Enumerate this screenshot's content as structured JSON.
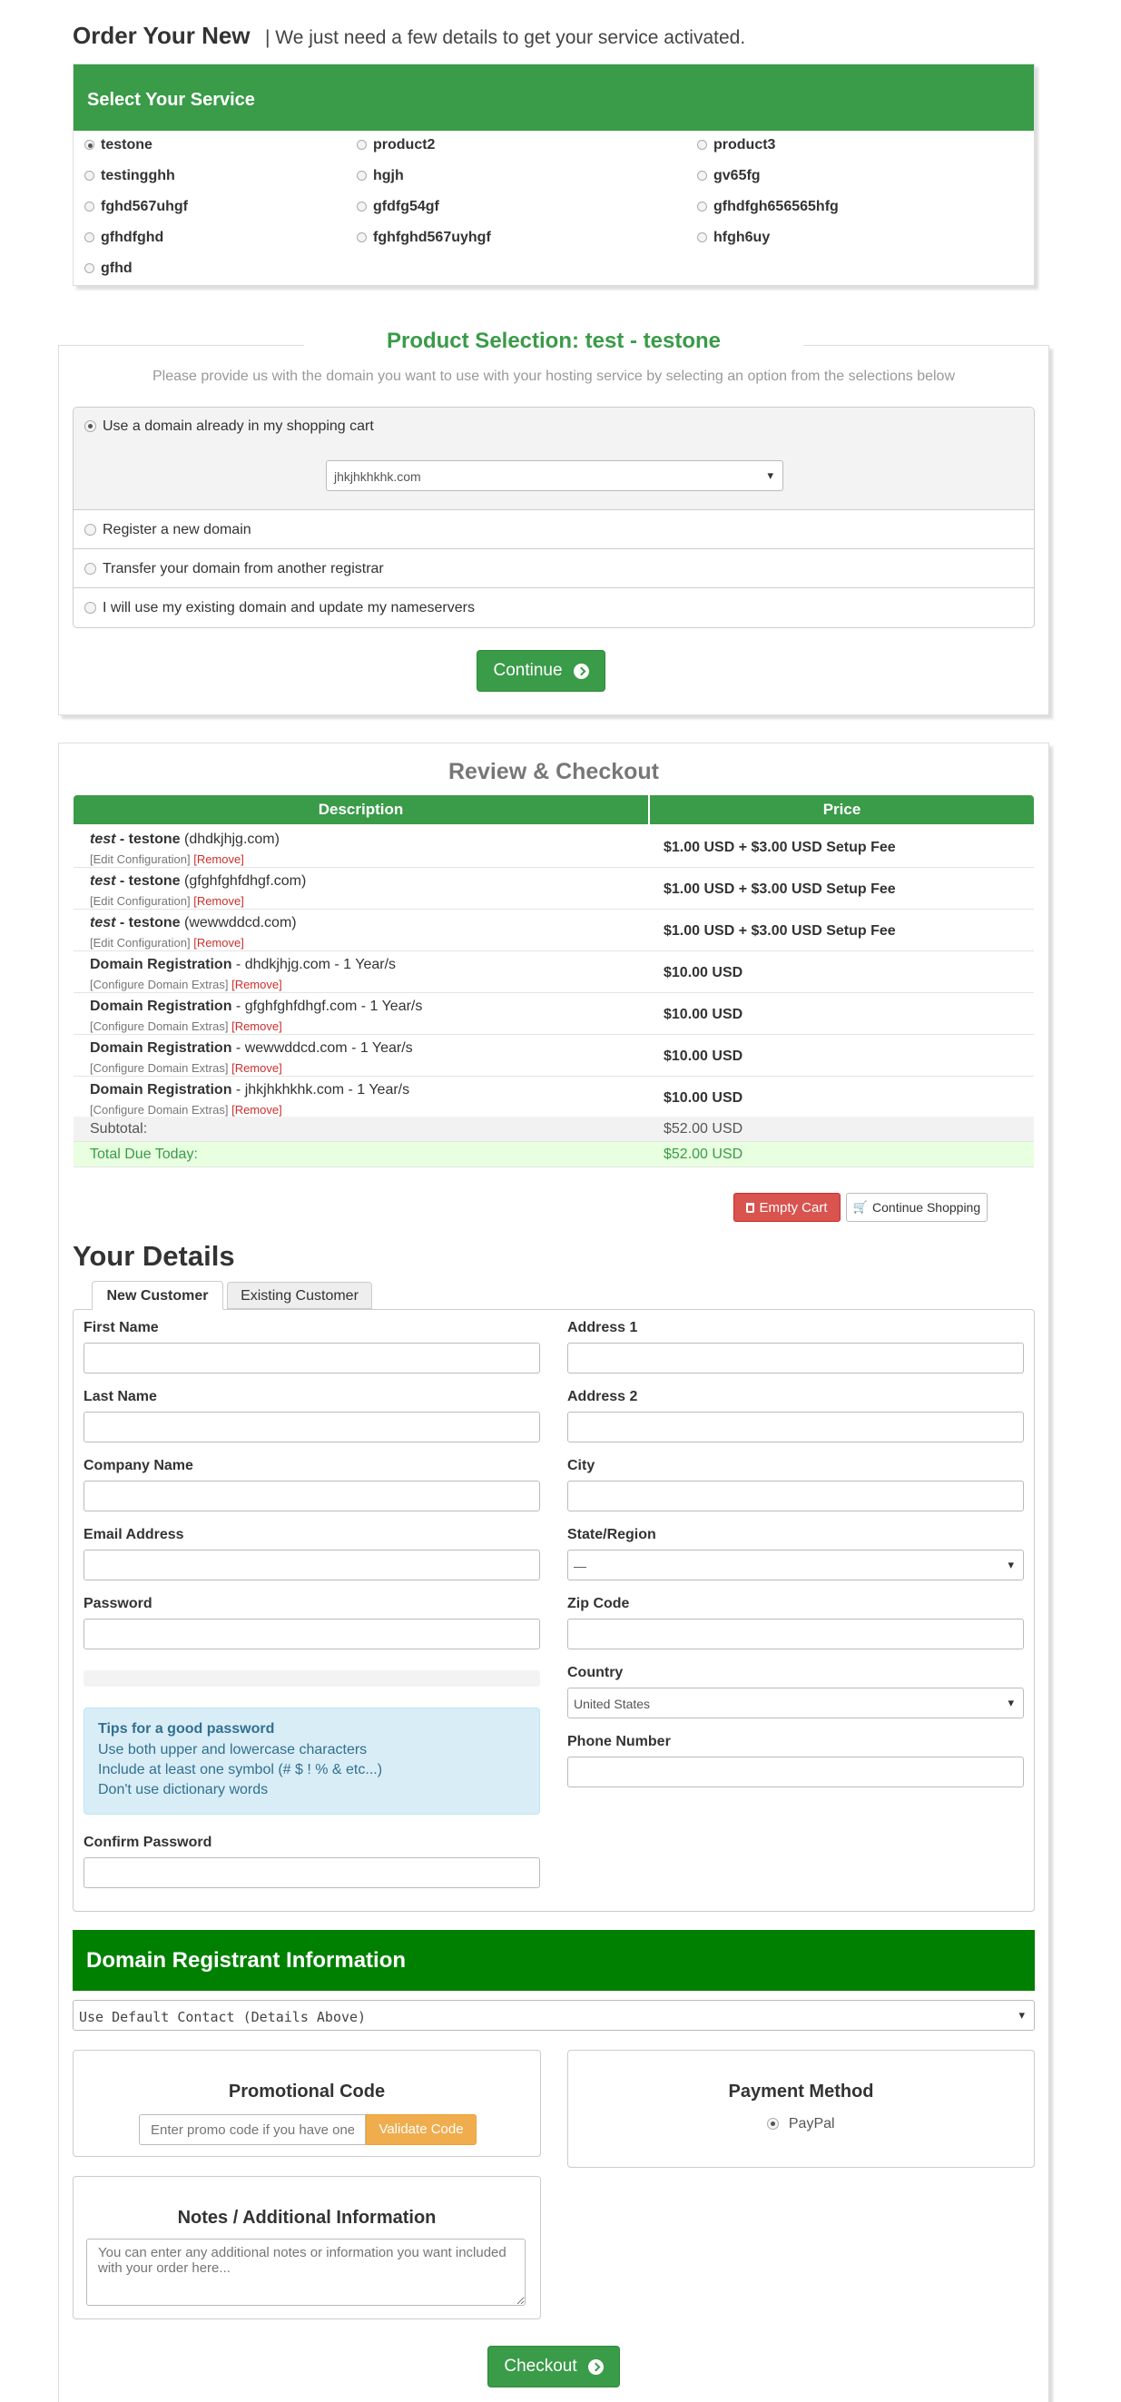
{
  "header": {
    "title": "Order Your New",
    "subtitle": "| We just need a few details to get your service activated."
  },
  "services": {
    "heading": "Select Your Service",
    "items": [
      "testone",
      "product2",
      "product3",
      "testingghh",
      "hgjh",
      "gv65fg",
      "fghd567uhgf",
      "gfdfg54gf",
      "gfhdfgh656565hfg",
      "gfhdfghd",
      "fghfghd567uyhgf",
      "hfgh6uy",
      "gfhd"
    ],
    "selected": "testone"
  },
  "product_selection": {
    "title": "Product Selection: test - testone",
    "description": "Please provide us with the domain you want to use with your hosting service by selecting an option from the selections below",
    "options": [
      "Use a domain already in my shopping cart",
      "Register a new domain",
      "Transfer your domain from another registrar",
      "I will use my existing domain and update my nameservers"
    ],
    "selected_option": 0,
    "cart_domain": "jhkjhkhkhk.com",
    "continue_label": "Continue"
  },
  "review": {
    "title": "Review & Checkout",
    "columns": [
      "Description",
      "Price"
    ],
    "rows": [
      {
        "italic": "test",
        "bold": " - testone",
        "rest": " (dhdkjhjg.com)",
        "sub": "[Edit Configuration]",
        "remove": "[Remove]",
        "price": "$1.00 USD + $3.00 USD Setup Fee"
      },
      {
        "italic": "test",
        "bold": " - testone",
        "rest": " (gfghfghfdhgf.com)",
        "sub": "[Edit Configuration]",
        "remove": "[Remove]",
        "price": "$1.00 USD + $3.00 USD Setup Fee"
      },
      {
        "italic": "test",
        "bold": " - testone",
        "rest": " (wewwddcd.com)",
        "sub": "[Edit Configuration]",
        "remove": "[Remove]",
        "price": "$1.00 USD + $3.00 USD Setup Fee"
      },
      {
        "italic": "",
        "bold": "Domain Registration",
        "rest": " - dhdkjhjg.com - 1 Year/s",
        "sub": "[Configure Domain Extras]",
        "remove": "[Remove]",
        "price": "$10.00 USD"
      },
      {
        "italic": "",
        "bold": "Domain Registration",
        "rest": " - gfghfghfdhgf.com - 1 Year/s",
        "sub": "[Configure Domain Extras]",
        "remove": "[Remove]",
        "price": "$10.00 USD"
      },
      {
        "italic": "",
        "bold": "Domain Registration",
        "rest": " - wewwddcd.com - 1 Year/s",
        "sub": "[Configure Domain Extras]",
        "remove": "[Remove]",
        "price": "$10.00 USD"
      },
      {
        "italic": "",
        "bold": "Domain Registration",
        "rest": " - jhkjhkhkhk.com - 1 Year/s",
        "sub": "[Configure Domain Extras]",
        "remove": "[Remove]",
        "price": "$10.00 USD"
      }
    ],
    "subtotal_label": "Subtotal:",
    "subtotal": "$52.00 USD",
    "total_label": "Total Due Today:",
    "total": "$52.00 USD",
    "empty_cart": "Empty Cart",
    "continue_shopping": "Continue Shopping"
  },
  "details": {
    "title": "Your Details",
    "tabs": [
      "New Customer",
      "Existing Customer"
    ],
    "left_fields": [
      "First Name",
      "Last Name",
      "Company Name",
      "Email Address",
      "Password"
    ],
    "right_fields": [
      "Address 1",
      "Address 2",
      "City",
      "State/Region",
      "Zip Code",
      "Country",
      "Phone Number"
    ],
    "state_value": "—",
    "country_value": "United States",
    "tips_title": "Tips for a good password",
    "tips": [
      "Use both upper and lowercase characters",
      "Include at least one symbol (# $ ! % & etc...)",
      "Don't use dictionary words"
    ],
    "confirm_password": "Confirm Password"
  },
  "registrant": {
    "title": "Domain Registrant Information",
    "select_value": "Use Default Contact (Details Above)"
  },
  "promo": {
    "title": "Promotional Code",
    "placeholder": "Enter promo code if you have one",
    "button": "Validate Code"
  },
  "payment": {
    "title": "Payment Method",
    "option": "PayPal"
  },
  "notes": {
    "title": "Notes / Additional Information",
    "placeholder": "You can enter any additional notes or information you want included with your order here..."
  },
  "checkout_label": "Checkout",
  "colors": {
    "green": "#3a9b48",
    "dark_green": "#008000",
    "red": "#d9534f",
    "orange": "#f0ad4e",
    "tips_bg": "#d9edf7"
  }
}
